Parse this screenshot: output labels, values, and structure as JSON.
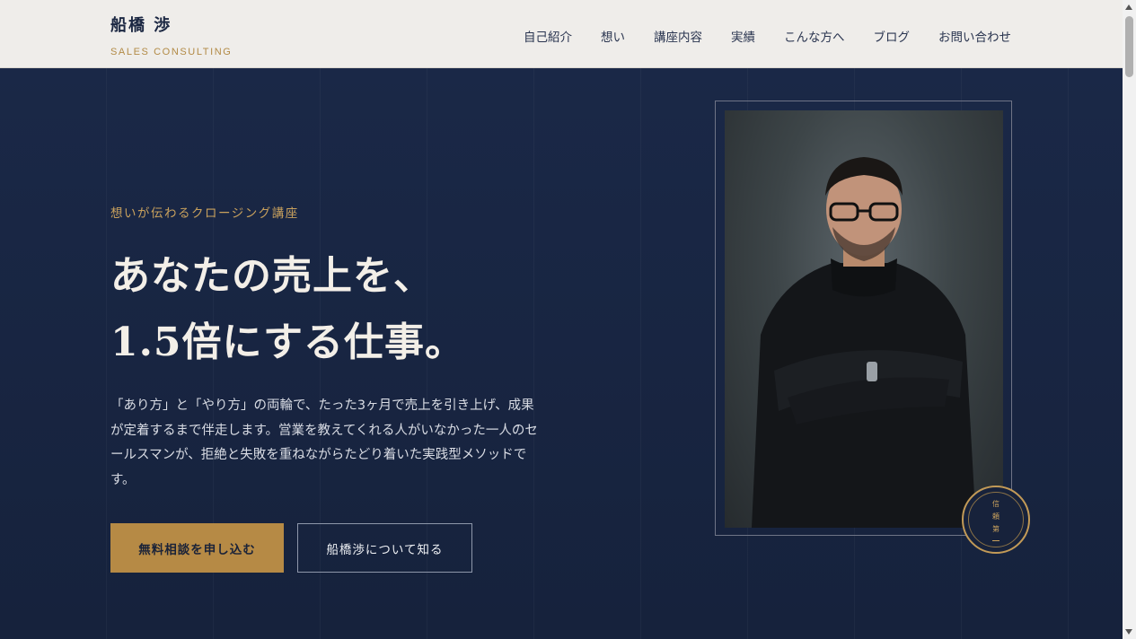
{
  "header": {
    "brand_name": "船橋 渉",
    "brand_sub": "SALES CONSULTING",
    "nav": [
      "自己紹介",
      "想い",
      "講座内容",
      "実績",
      "こんな方へ",
      "ブログ",
      "お問い合わせ"
    ]
  },
  "hero": {
    "eyebrow": "想いが伝わるクロージング講座",
    "headline_line1": "あなたの売上を、",
    "headline_line2": "1.5倍にする仕事。",
    "body": "「あり方」と「やり方」の両輪で、たった3ヶ月で売上を引き上げ、成果が定着するまで伴走します。営業を教えてくれる人がいなかった一人のセールスマンが、拒絶と失敗を重ねながらたどり着いた実践型メソッドです。",
    "primary_button": "無料相談を申し込む",
    "secondary_button": "船橋渉について知る"
  },
  "badge": {
    "chars": [
      "信",
      "頼",
      "第"
    ]
  },
  "colors": {
    "navy": "#16233d",
    "gold": "#b68a45",
    "header_bg": "#efedea"
  }
}
